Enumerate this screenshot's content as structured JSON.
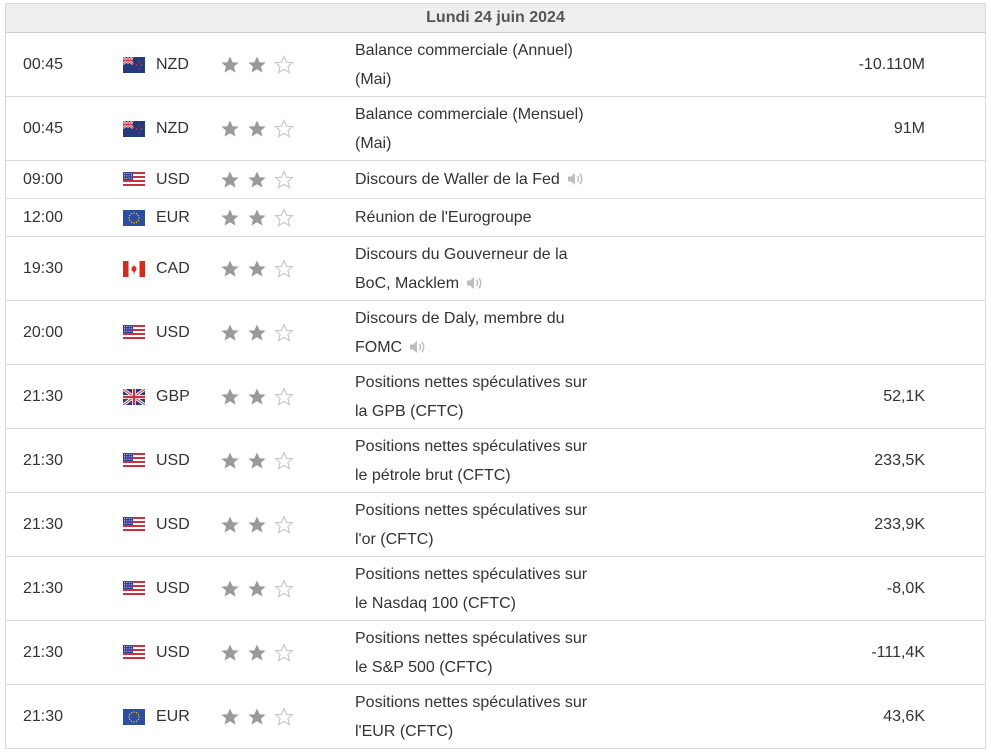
{
  "day_header": "Lundi 24 juin 2024",
  "events": [
    {
      "time": "00:45",
      "flag": "NZ",
      "currency": "NZD",
      "importance": 2,
      "lines": [
        "Balance commerciale (Annuel)",
        "(Mai)"
      ],
      "speech": false,
      "actual": "-10.110M"
    },
    {
      "time": "00:45",
      "flag": "NZ",
      "currency": "NZD",
      "importance": 2,
      "lines": [
        "Balance commerciale (Mensuel)",
        "(Mai)"
      ],
      "speech": false,
      "actual": "91M"
    },
    {
      "time": "09:00",
      "flag": "US",
      "currency": "USD",
      "importance": 2,
      "lines": [
        "Discours de Waller de la Fed"
      ],
      "speech": true,
      "actual": ""
    },
    {
      "time": "12:00",
      "flag": "EU",
      "currency": "EUR",
      "importance": 2,
      "lines": [
        "Réunion de l'Eurogroupe"
      ],
      "speech": false,
      "actual": ""
    },
    {
      "time": "19:30",
      "flag": "CA",
      "currency": "CAD",
      "importance": 2,
      "lines": [
        "Discours du Gouverneur de la",
        "BoC, Macklem"
      ],
      "speech": true,
      "actual": ""
    },
    {
      "time": "20:00",
      "flag": "US",
      "currency": "USD",
      "importance": 2,
      "lines": [
        "Discours de Daly, membre du",
        "FOMC"
      ],
      "speech": true,
      "actual": ""
    },
    {
      "time": "21:30",
      "flag": "GB",
      "currency": "GBP",
      "importance": 2,
      "lines": [
        "Positions nettes spéculatives sur",
        "la GPB (CFTC)"
      ],
      "speech": false,
      "actual": "52,1K"
    },
    {
      "time": "21:30",
      "flag": "US",
      "currency": "USD",
      "importance": 2,
      "lines": [
        "Positions nettes spéculatives sur",
        "le pétrole brut (CFTC)"
      ],
      "speech": false,
      "actual": "233,5K"
    },
    {
      "time": "21:30",
      "flag": "US",
      "currency": "USD",
      "importance": 2,
      "lines": [
        "Positions nettes spéculatives sur",
        "l'or (CFTC)"
      ],
      "speech": false,
      "actual": "233,9K"
    },
    {
      "time": "21:30",
      "flag": "US",
      "currency": "USD",
      "importance": 2,
      "lines": [
        "Positions nettes spéculatives sur",
        "le Nasdaq 100 (CFTC)"
      ],
      "speech": false,
      "actual": "-8,0K"
    },
    {
      "time": "21:30",
      "flag": "US",
      "currency": "USD",
      "importance": 2,
      "lines": [
        "Positions nettes spéculatives sur",
        "le S&P 500 (CFTC)"
      ],
      "speech": false,
      "actual": "-111,4K"
    },
    {
      "time": "21:30",
      "flag": "EU",
      "currency": "EUR",
      "importance": 2,
      "lines": [
        "Positions nettes spéculatives sur",
        "l'EUR (CFTC)"
      ],
      "speech": false,
      "actual": "43,6K"
    }
  ],
  "colors": {
    "star_filled": "#9a9a9a",
    "star_empty": "#c8c8c8",
    "header_bg": "#eeeeee",
    "border": "#dadada"
  },
  "icons": {
    "importance": "star-icon",
    "speech": "speaker-icon"
  }
}
